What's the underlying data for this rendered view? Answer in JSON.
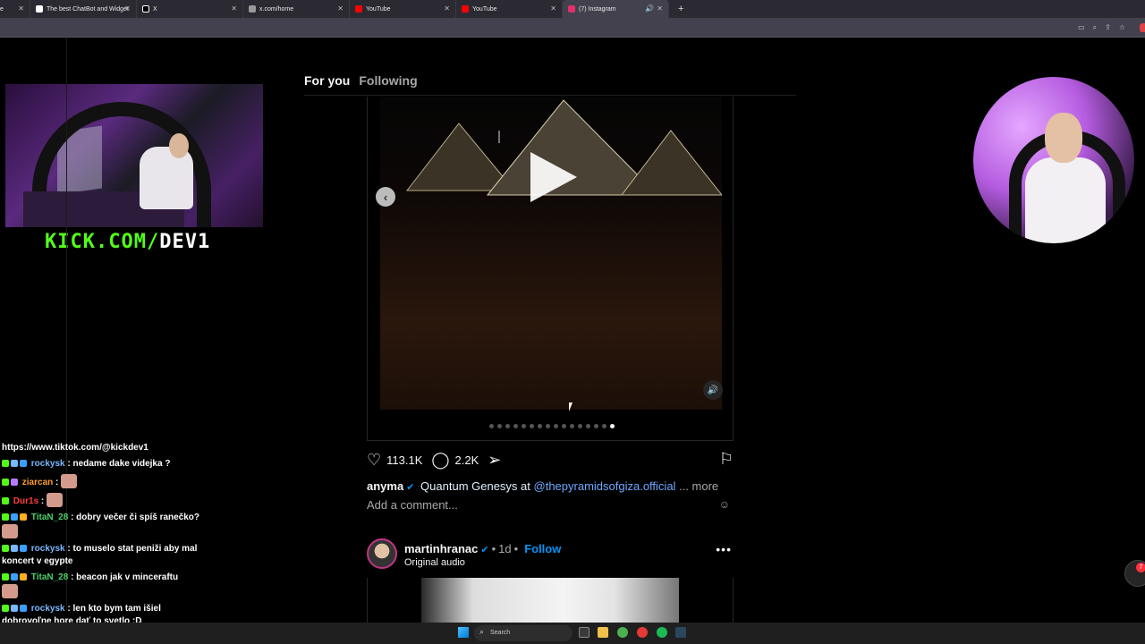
{
  "browser": {
    "tabs": [
      {
        "label": "e",
        "color": "#888888"
      },
      {
        "label": "The best ChatBot and Widget",
        "color": "#ffffff"
      },
      {
        "label": "X",
        "color": "#ffffff"
      },
      {
        "label": "x.com/home",
        "color": "#999999"
      },
      {
        "label": "YouTube",
        "color": "#ff0000"
      },
      {
        "label": "YouTube",
        "color": "#ff0000"
      },
      {
        "label": "(7) Instagram",
        "color": "#e1306c"
      }
    ],
    "new_tab_label": "+"
  },
  "stream": {
    "kick_prefix": "KICK.COM/",
    "kick_suffix": "DEV1"
  },
  "feed": {
    "tab_for_you": "For you",
    "tab_following": "Following"
  },
  "post1": {
    "likes": "113.1K",
    "comments": "2.2K",
    "author": "anyma",
    "caption_text": "Quantum Genesys at",
    "mention": "@thepyramidsofgiza.official",
    "more": "... more",
    "comment_placeholder": "Add a comment...",
    "carousel_count": 16,
    "carousel_active": 15
  },
  "post2": {
    "author": "martinhranac",
    "separator": "•",
    "time": "1d",
    "sep2": "•",
    "follow": "Follow",
    "audio": "Original audio"
  },
  "chat": {
    "link": "https://www.tiktok.com/@kickdev1",
    "messages": [
      {
        "user": "rockysk",
        "color": "#7ab7ff",
        "text": ": nedame dake videjka ?"
      },
      {
        "user": "ziarcan",
        "color": "#ff9d2e",
        "text": ":"
      },
      {
        "user": "Dur1s",
        "color": "#ff3b3b",
        "text": ":"
      },
      {
        "user": "TitaN_28",
        "color": "#4ccf6a",
        "text": ": dobry večer či spíš ranečko?"
      },
      {
        "user": "rockysk",
        "color": "#7ab7ff",
        "text": ": to muselo stat peniži aby mal koncert v egypte"
      },
      {
        "user": "TitaN_28",
        "color": "#4ccf6a",
        "text": ": beacon jak v minceraftu"
      },
      {
        "user": "rockysk",
        "color": "#7ab7ff",
        "text": ": len kto bym tam išiel"
      }
    ],
    "trailing": "dobrovoľne hore dať to svetlo :D"
  },
  "taskbar": {
    "search_placeholder": "Search"
  },
  "fab_badge": "7"
}
